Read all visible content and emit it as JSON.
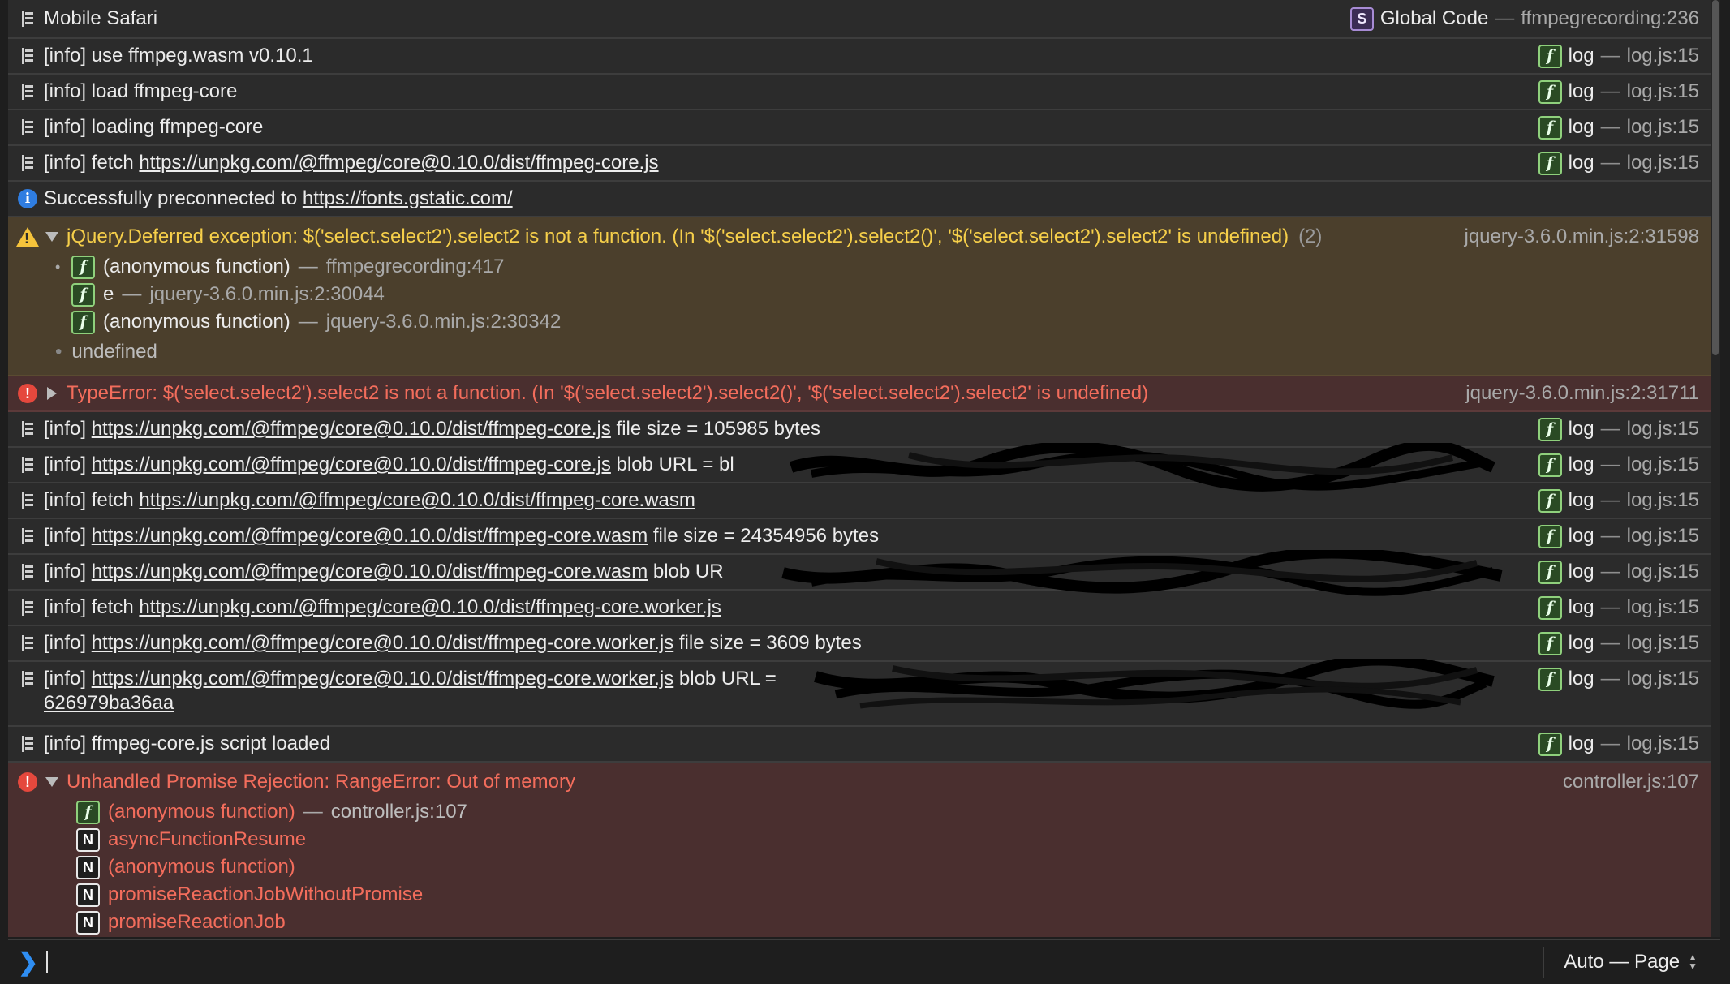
{
  "header": {
    "title": "Mobile Safari",
    "badge": "S",
    "scope": "Global Code",
    "separator": "—",
    "location": "ffmpegrecording:236"
  },
  "log_source": {
    "badge": "f",
    "label": "log",
    "separator": "—",
    "file": "log.js:15"
  },
  "rows": {
    "r1": {
      "text": "[info] use ffmpeg.wasm v0.10.1"
    },
    "r2": {
      "text": "[info] load ffmpeg-core"
    },
    "r3": {
      "text": "[info] loading ffmpeg-core"
    },
    "r4": {
      "prefix": "[info] fetch ",
      "link": "https://unpkg.com/@ffmpeg/core@0.10.0/dist/ffmpeg-core.js"
    },
    "r5": {
      "prefix": "Successfully preconnected to ",
      "link": "https://fonts.gstatic.com/"
    },
    "r7": {
      "prefix": "[info] ",
      "link": "https://unpkg.com/@ffmpeg/core@0.10.0/dist/ffmpeg-core.js",
      "suffix": " file size = 105985 bytes"
    },
    "r8": {
      "prefix": "[info] ",
      "link": "https://unpkg.com/@ffmpeg/core@0.10.0/dist/ffmpeg-core.js",
      "suffix": " blob URL = bl"
    },
    "r9": {
      "prefix": "[info] fetch ",
      "link": "https://unpkg.com/@ffmpeg/core@0.10.0/dist/ffmpeg-core.wasm"
    },
    "r10": {
      "prefix": "[info] ",
      "link": "https://unpkg.com/@ffmpeg/core@0.10.0/dist/ffmpeg-core.wasm",
      "suffix": " file size = 24354956 bytes"
    },
    "r11": {
      "prefix": "[info] ",
      "link": "https://unpkg.com/@ffmpeg/core@0.10.0/dist/ffmpeg-core.wasm",
      "suffix": " blob UR"
    },
    "r12": {
      "prefix": "[info] fetch ",
      "link": "https://unpkg.com/@ffmpeg/core@0.10.0/dist/ffmpeg-core.worker.js"
    },
    "r13": {
      "prefix": "[info] ",
      "link": "https://unpkg.com/@ffmpeg/core@0.10.0/dist/ffmpeg-core.worker.js",
      "suffix": " file size = 3609 bytes"
    },
    "r14": {
      "prefix": "[info] ",
      "link": "https://unpkg.com/@ffmpeg/core@0.10.0/dist/ffmpeg-core.worker.js",
      "suffix": " blob URL = ",
      "wrap_link": "626979ba36aa"
    },
    "r15": {
      "text": "[info] ffmpeg-core.js script loaded"
    }
  },
  "warning": {
    "text": "jQuery.Deferred exception: $('select.select2').select2 is not a function. (In '$('select.select2').select2()', '$('select.select2').select2' is undefined)",
    "count": "(2)",
    "location": "jquery-3.6.0.min.js:2:31598",
    "trace": [
      {
        "fn": "(anonymous function)",
        "loc": "ffmpegrecording:417"
      },
      {
        "fn": "e",
        "loc": "jquery-3.6.0.min.js:2:30044"
      },
      {
        "fn": "(anonymous function)",
        "loc": "jquery-3.6.0.min.js:2:30342"
      }
    ],
    "value": "undefined"
  },
  "type_error": {
    "text": "TypeError: $('select.select2').select2 is not a function. (In '$('select.select2').select2()', '$('select.select2').select2' is undefined)",
    "location": "jquery-3.6.0.min.js:2:31711"
  },
  "rejection": {
    "text": "Unhandled Promise Rejection: RangeError: Out of memory",
    "location": "controller.js:107",
    "trace": [
      {
        "badge": "f",
        "fn": "(anonymous function)",
        "loc": "controller.js:107"
      },
      {
        "badge": "N",
        "fn": "asyncFunctionResume"
      },
      {
        "badge": "N",
        "fn": "(anonymous function)"
      },
      {
        "badge": "N",
        "fn": "promiseReactionJobWithoutPromise"
      },
      {
        "badge": "N",
        "fn": "promiseReactionJob"
      }
    ]
  },
  "prompt": {
    "chevron": "❯",
    "mode": "Auto — Page"
  },
  "colors": {
    "warning": "#f6cf4a",
    "error": "#f36d5c",
    "info": "#2f7de1",
    "function_badge": "#8fd07c"
  }
}
